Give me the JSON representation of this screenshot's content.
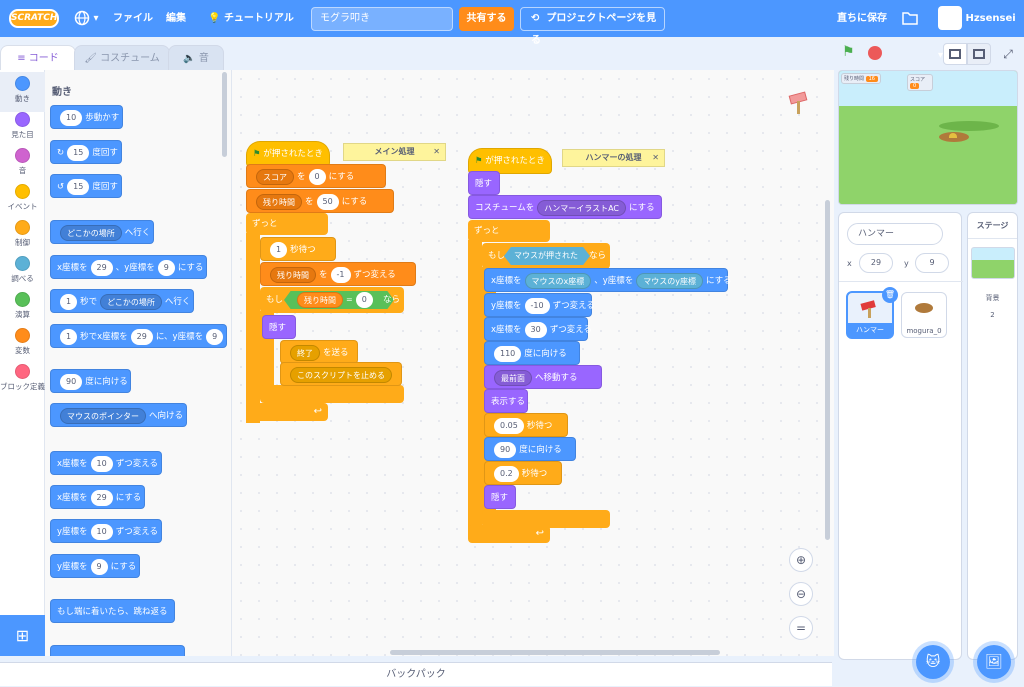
{
  "menubar": {
    "logo": "SCRATCH",
    "file": "ファイル",
    "edit": "編集",
    "tutorials": "チュートリアル",
    "project_title": "モグラ叩き",
    "share": "共有する",
    "see_project": "プロジェクトページを見る",
    "save_now": "直ちに保存",
    "username": "Hzsensei"
  },
  "tabs": {
    "code": "コード",
    "costumes": "コスチューム",
    "sounds": "音"
  },
  "categories": [
    {
      "label": "動き",
      "color": "#4c97ff"
    },
    {
      "label": "見た目",
      "color": "#9966ff"
    },
    {
      "label": "音",
      "color": "#cf63cf"
    },
    {
      "label": "イベント",
      "color": "#ffbf00"
    },
    {
      "label": "制御",
      "color": "#ffab19"
    },
    {
      "label": "調べる",
      "color": "#5cb1d6"
    },
    {
      "label": "演算",
      "color": "#59c059"
    },
    {
      "label": "変数",
      "color": "#ff8c1a"
    },
    {
      "label": "ブロック定義",
      "color": "#ff6680"
    }
  ],
  "palette": {
    "title": "動き",
    "move": {
      "n": "10",
      "t": "歩動かす"
    },
    "turn_r": {
      "n": "15",
      "t": "度回す"
    },
    "turn_l": {
      "n": "15",
      "t": "度回す"
    },
    "goto": {
      "d": "どこかの場所",
      "t": "へ行く"
    },
    "gotoxy": {
      "a": "x座標を",
      "x": "29",
      "b": "、y座標を",
      "y": "9",
      "c": "にする"
    },
    "glide": {
      "n": "1",
      "a": "秒で",
      "d": "どこかの場所",
      "t": "へ行く"
    },
    "glidexy": {
      "n": "1",
      "a": "秒でx座標を",
      "x": "29",
      "b": "に、y座標を",
      "y": "9"
    },
    "point": {
      "n": "90",
      "t": "度に向ける"
    },
    "pointto": {
      "d": "マウスのポインター",
      "t": "へ向ける"
    },
    "changex": {
      "a": "x座標を",
      "n": "10",
      "t": "ずつ変える"
    },
    "setx": {
      "a": "x座標を",
      "n": "29",
      "t": "にする"
    },
    "changey": {
      "a": "y座標を",
      "n": "10",
      "t": "ずつ変える"
    },
    "sety": {
      "a": "y座標を",
      "n": "9",
      "t": "にする"
    },
    "bounce": "もし端に着いたら、跳ね返る"
  },
  "script1": {
    "hat": "が押されたとき",
    "comment": "メイン処理",
    "set_score": {
      "var": "スコア",
      "a": "を",
      "v": "0",
      "t": "にする"
    },
    "set_time": {
      "var": "残り時間",
      "a": "を",
      "v": "50",
      "t": "にする"
    },
    "forever": "ずっと",
    "wait": {
      "n": "1",
      "t": "秒待つ"
    },
    "change_time": {
      "var": "残り時間",
      "a": "を",
      "v": "-1",
      "t": "ずつ変える"
    },
    "if": "もし",
    "cond": {
      "var": "残り時間",
      "op": "=",
      "v": "0"
    },
    "then": "なら",
    "hide": "隠す",
    "broadcast": {
      "msg": "終了",
      "t": "を送る"
    },
    "stop": "このスクリプトを止める"
  },
  "script2": {
    "hat": "が押されたとき",
    "comment": "ハンマーの処理",
    "hide": "隠す",
    "costume": {
      "a": "コスチュームを",
      "d": "ハンマーイラストAC",
      "t": "にする"
    },
    "forever": "ずっと",
    "if": "もし",
    "cond": "マウスが押された",
    "then": "なら",
    "gotoxy": {
      "a": "x座標を",
      "x": "マウスのx座標",
      "b": "、y座標を",
      "y": "マウスのy座標",
      "c": "にする"
    },
    "changey": {
      "a": "y座標を",
      "n": "-10",
      "t": "ずつ変える"
    },
    "changex": {
      "a": "x座標を",
      "n": "30",
      "t": "ずつ変える"
    },
    "point1": {
      "n": "110",
      "t": "度に向ける"
    },
    "layer": {
      "d": "最前面",
      "t": "へ移動する"
    },
    "show": "表示する",
    "wait1": {
      "n": "0.05",
      "t": "秒待つ"
    },
    "point2": {
      "n": "90",
      "t": "度に向ける"
    },
    "wait2": {
      "n": "0.2",
      "t": "秒待つ"
    },
    "hide2": "隠す"
  },
  "stage": {
    "timer_label": "残り時間",
    "timer_value": "16",
    "score_label": "スコア",
    "score_value": "0"
  },
  "sprite_info": {
    "name": "ハンマー",
    "x_label": "x",
    "x": "29",
    "y_label": "y",
    "y": "9"
  },
  "sprites": [
    {
      "name": "ハンマー",
      "selected": true
    },
    {
      "name": "mogura_0",
      "selected": false
    }
  ],
  "stage_pane": {
    "title": "ステージ",
    "backdrop_label": "背景",
    "backdrop_count": "2"
  },
  "backpack": "バックパック",
  "colors": {
    "accent": "#4c97ff",
    "motion": "#4c97ff",
    "looks": "#9966ff",
    "events": "#ffbf00",
    "control": "#ffab19",
    "variables": "#ff8c1a",
    "operators": "#59c059"
  }
}
